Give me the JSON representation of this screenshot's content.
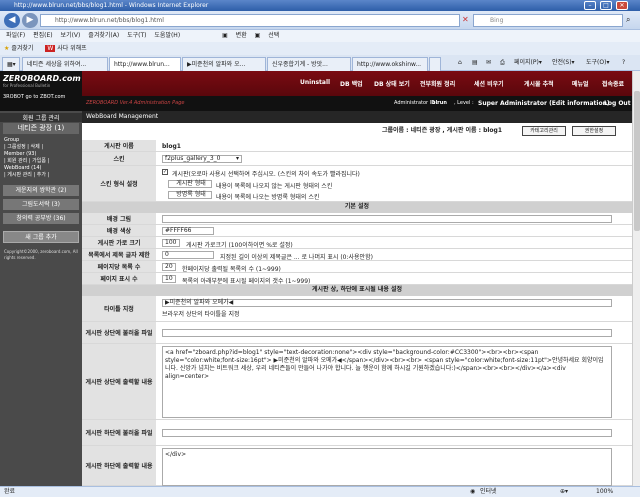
{
  "window": {
    "title": "http://www.blrun.net/bbs/blog1.html - Windows Internet Explorer"
  },
  "address": {
    "url": "http://www.blrun.net/bbs/blog1.html",
    "search_placeholder": "Bing"
  },
  "menu": [
    "파일(F)",
    "편집(E)",
    "보기(V)",
    "즐겨찾기(A)",
    "도구(T)",
    "도움말(H)"
  ],
  "menu_extra": {
    "convert": "변환",
    "select": "선택"
  },
  "favorites": {
    "label": "즐겨찾기",
    "item": "사다 위해프"
  },
  "tabs": [
    "네티즌 세상을 위하여...",
    "http://www.blrun...",
    "▶미준천의 알파와 오...",
    "신우종합기계 - 방앗...",
    "http://www.okshinw..."
  ],
  "right_tools": {
    "page": "페이지(P)",
    "safety": "안전(S)",
    "tools": "도구(O)"
  },
  "admin": {
    "logo_title": "ZEROBOARD.com",
    "logo_sub": "for Professional Bulletin",
    "logo_bottom": "3ROBOT go to ZBOT.com",
    "nav": [
      "Uninstall",
      "DB 백업",
      "DB 상태 보기",
      "전부회원 정리",
      "세션 비우기",
      "게시물 추적",
      "메뉴얼",
      "접속종료"
    ],
    "subtitle": "ZEROBOARD Ver.4 Administration Page",
    "admin_id_label": "Administrator ID :",
    "admin_id": "blrun",
    "level_label": ", Level :",
    "level": "Super Administrator (Edit information)",
    "logout": "Log Out"
  },
  "sidebar": {
    "header": "회원 그룹 관리",
    "group": "네티즌 광장 (1)",
    "group_info": [
      "Group",
      "| 그룹설정 | 삭제 |",
      "Member (93)",
      "| 회원 관리 | 가입폼 |",
      "WebBoard (14)",
      "| 게시판 관리 | 추가 |"
    ],
    "items": [
      "게운지의 쌍학관 (2)",
      "그림도서락 (3)",
      "창의력 공부방 (36)"
    ],
    "add_button": "새 그룹 추가",
    "copyright": "Copyright©2000, zeroboard.com, All rights reserved."
  },
  "main": {
    "title": "WebBoard Management",
    "group_info": "그룹이름 : 네티즌 광장 , 게시판 이름 : blog1",
    "btn_category": "카테고리관리",
    "btn_permission": "권한설정",
    "board_name_label": "게시판 이름",
    "board_name": "blog1",
    "skin_label": "스킨",
    "skin": "f2plus_gallery_3_0",
    "skin_style_label": "스킨 형식 설정",
    "skin_style_checkbox": "게시판(오로마 사용시 선택하여 주십시오. (스킨의 차이 속도가 빨라집니다)",
    "skin_style_btn1": "게시판 형태",
    "skin_style_desc1": "내용이 목록에 나오지 않는 게시판 형태의 스킨",
    "skin_style_btn2": "방명록 형태",
    "skin_style_desc2": "내용이 목록에 나오는 방명록 형태의 스킨",
    "section_basic": "기본 설정",
    "bg_image_label": "배경 그림",
    "bg_color_label": "배경 색상",
    "bg_color": "#FFFF66",
    "width_label": "게시판 가로 크기",
    "width": "100",
    "width_desc": "게시판 가로크기 (100이하이면 %로 설정)",
    "cut_label": "목록에서 제목 글자 제한",
    "cut": "0",
    "cut_desc": "지정된 길이 이상의 제목글은 ... 로 나머지 표시 (0:사용안함)",
    "perpage_label": "페이지당 목록 수",
    "perpage": "20",
    "perpage_desc": "한페이지당 출력될 목록의 수 (1~999)",
    "pages_label": "페이지 표시 수",
    "pages": "10",
    "pages_desc": "목록의 아래부분에 표시될 페이지의 갯수 (1~999)",
    "section_header": "게시판 상, 하단에 표시될 내용 설정",
    "title_label": "타이틀 지정",
    "title_value": "▶미준천의 알파와 오메가◀",
    "title_help": "브라우저 상단의 타이틀을 지정",
    "header_file_label": "게시판 상단에 불러올 파일",
    "header_content_label": "게시판 상단에 출력할 내용",
    "header_content": "<a href=\"zboard.php?id=blog1\" style=\"text-decoration:none\"><div style=\"background-color:#CC3300\"><br><br><span style=\"color:white;font-size:16pt\">    ▶미준천의 알파와 오메가◀</span></div><br><br>            <span style=\"color:white;font-size:11pt\">안녕하세요 회양이입니다. 신앙가 넘치는 비트워크 세상, 우리 네티즌들이 만들어 나가야 합니다. 늘 행운이 함께 하시길 기원하겠습니다:)</span><br><br></div></a><div align=center>",
    "footer_file_label": "게시판 하단에 불러올 파일",
    "footer_content_label": "게시판 하단에 출력할 내용",
    "footer_content": "</div>"
  },
  "status": {
    "left": "완료",
    "zone": "인터넷",
    "zoom": "100%"
  }
}
